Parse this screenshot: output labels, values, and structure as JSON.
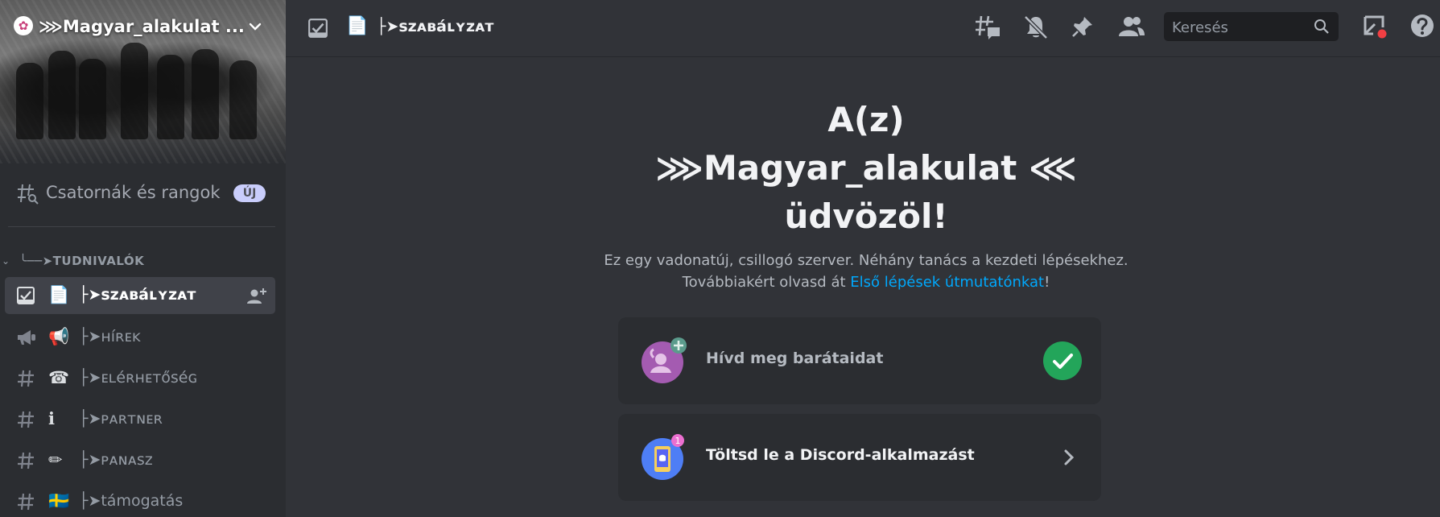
{
  "server": {
    "name": "⋙Magyar_alakulat ...",
    "channels_and_roles": "Csatornák és rangok",
    "new_badge": "ÚJ"
  },
  "category": {
    "name": "╰──➤TUDNIVALÓK"
  },
  "channels": [
    {
      "icon": "rules-icon",
      "emoji": "📄",
      "name": "├➤ꜱᴢᴀʙáʟʏᴢᴀᴛ",
      "active": true
    },
    {
      "icon": "announcement-icon",
      "emoji": "📢",
      "name": "├➤ʜíʀᴇᴋ",
      "active": false
    },
    {
      "icon": "hashtag-icon",
      "emoji": "☎",
      "name": "├➤ᴇʟéʀʜᴇᴛőꜱéɢ",
      "active": false
    },
    {
      "icon": "hashtag-icon",
      "emoji": "ℹ",
      "name": "├➤ᴘᴀʀᴛɴᴇʀ",
      "active": false
    },
    {
      "icon": "hashtag-icon",
      "emoji": "✏",
      "name": "├➤ᴘᴀɴᴀꜱᴢ",
      "active": false
    },
    {
      "icon": "hashtag-icon",
      "emoji": "🇸🇪",
      "name": "├➤támogatás",
      "active": false
    }
  ],
  "topbar": {
    "emoji": "📄",
    "channel_title": "├➤ꜱᴢᴀʙáʟʏᴢᴀᴛ",
    "search_placeholder": "Keresés"
  },
  "welcome": {
    "line1": "A(z)",
    "line2": "⋙Magyar_alakulat ⋘",
    "line3": "üdvözöl!",
    "sub_before": "Ez egy vadonatúj, csillogó szerver. Néhány tanács a kezdeti lépésekhez. Továbbiakért olvasd át ",
    "sub_link": "Első lépések útmutatónkat",
    "sub_after": "!"
  },
  "cards": [
    {
      "label": "Hívd meg barátaidat",
      "done": true
    },
    {
      "label": "Töltsd le a Discord-alkalmazást",
      "done": false
    }
  ],
  "colors": {
    "accent_blue": "#00a8fc",
    "success_green": "#23a55a",
    "background": "#313338",
    "sidebar": "#2b2d31"
  }
}
